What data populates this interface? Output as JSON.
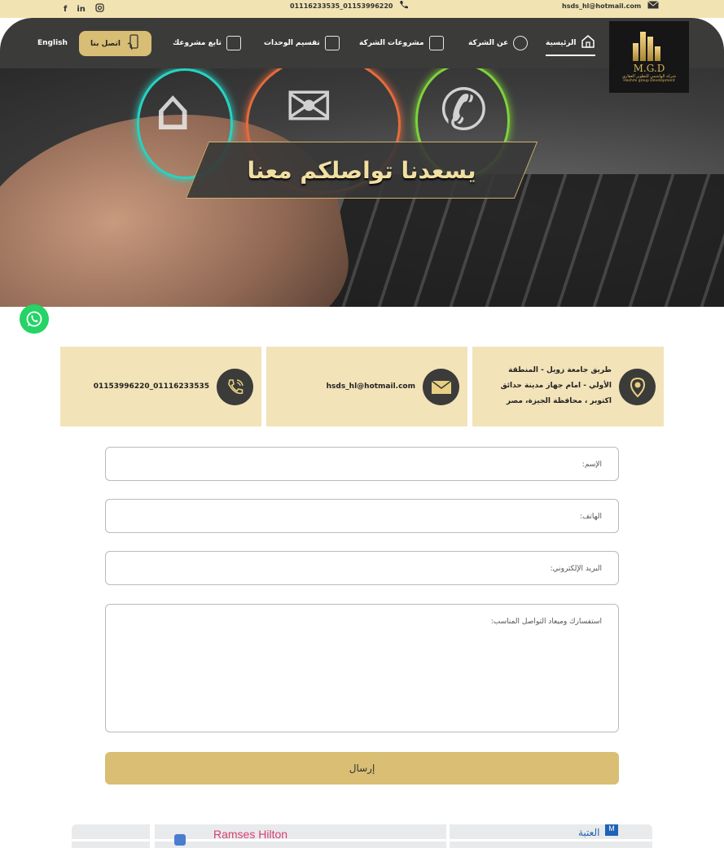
{
  "topbar": {
    "social": [
      "facebook",
      "linkedin",
      "instagram"
    ],
    "phone": "01116233535_01153996220",
    "email": "hsds_hl@hotmail.com"
  },
  "nav": {
    "lang": "English",
    "contact_label": "اتصل بنا",
    "items": [
      {
        "label": "الرئيسية",
        "icon": "home-icon"
      },
      {
        "label": "عن الشركة",
        "icon": "users-icon"
      },
      {
        "label": "مشروعات الشركة",
        "icon": "buildings-icon"
      },
      {
        "label": "تقسيم الوحدات",
        "icon": "document-icon"
      },
      {
        "label": "تابع مشروعك",
        "icon": "calendar-icon"
      }
    ]
  },
  "logo": {
    "brand": "M.G.D",
    "sub_ar": "شركة الهاشمي للتطوير العقاري",
    "sub_en": "Hashmi group Development"
  },
  "hero": {
    "title": "يسعدنا تواصلكم معنا"
  },
  "cards": {
    "address": "طريق جامعة زويل - المنطقة الأولي - امام جهاز مدينة حدائق اكتوبر ، محافظة الجيزة، مصر",
    "email": "hsds_hl@hotmail.com",
    "phone": "01116233535_01153996220"
  },
  "form": {
    "name_label": "الإسم:",
    "phone_label": "الهاتف:",
    "email_label": "البريد الإلكتروني:",
    "message_label": "استفسارك وميعاد التواصل المناسب:",
    "submit_label": "إرسال"
  },
  "map": {
    "place_label": "Ramses Hilton",
    "station_label": "العتبة",
    "metro_label": "M"
  },
  "colors": {
    "gold": "#d9be74",
    "dark": "#3b3b3a",
    "cream": "#f2e3b8"
  }
}
